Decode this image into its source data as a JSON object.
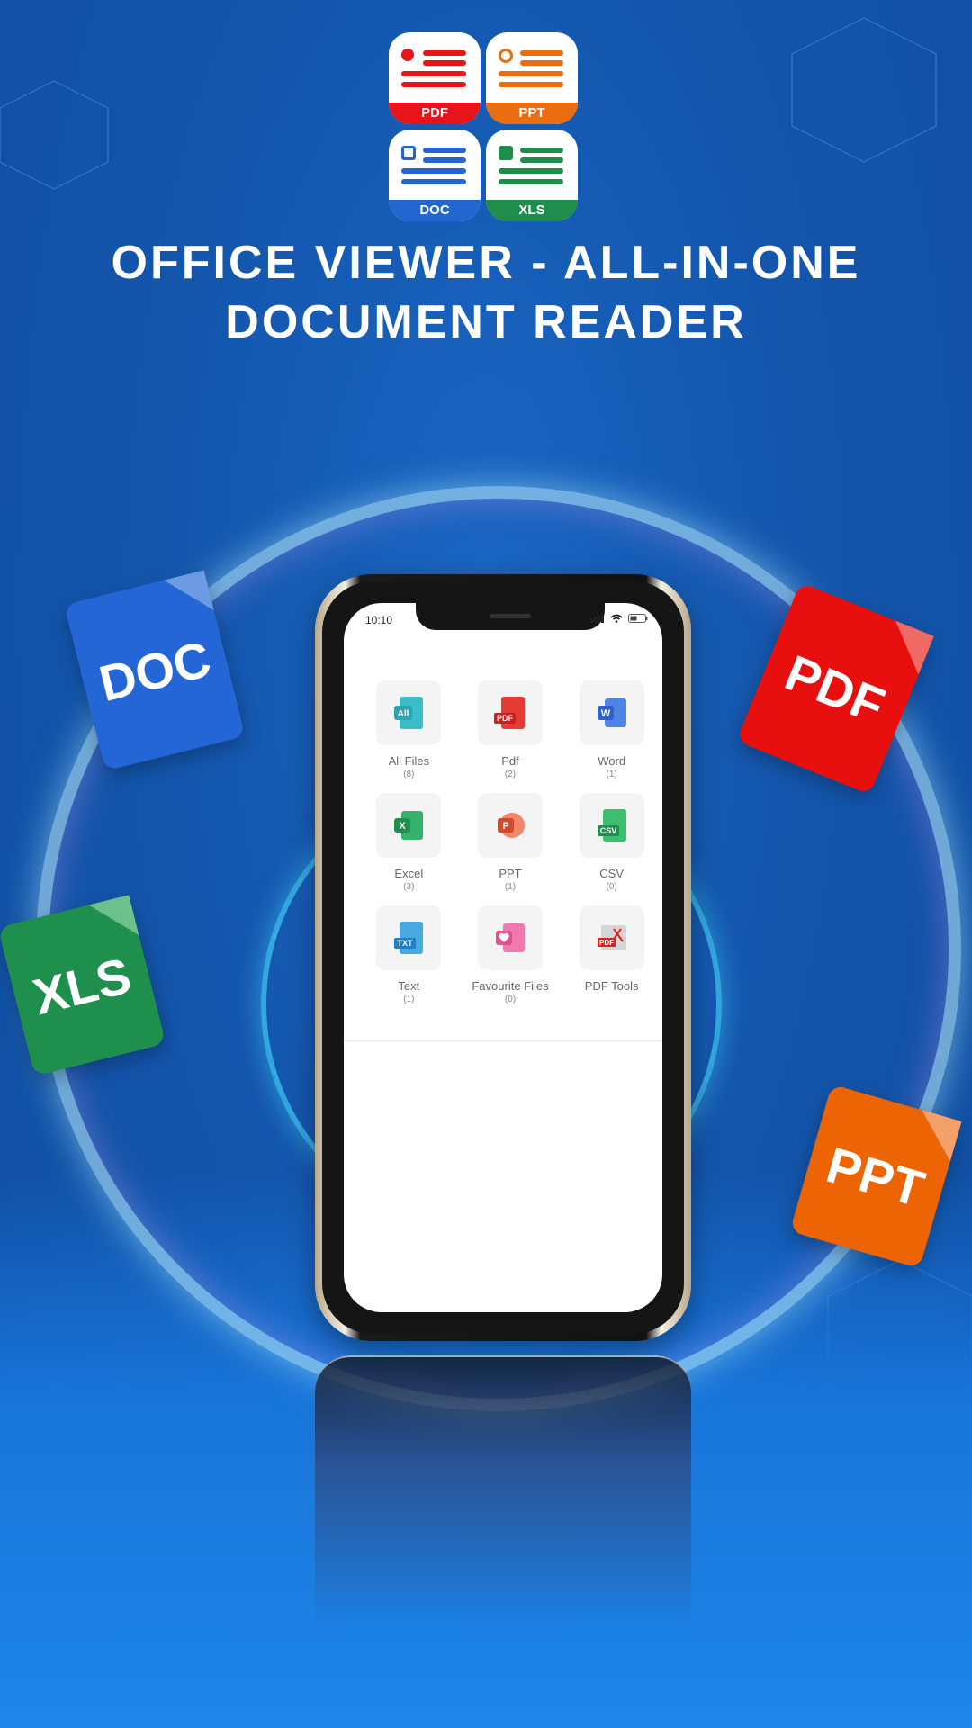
{
  "hero": {
    "logo_tiles": [
      {
        "label": "PDF",
        "color": "#e8141a"
      },
      {
        "label": "PPT",
        "color": "#ea6d10"
      },
      {
        "label": "DOC",
        "color": "#2466d0"
      },
      {
        "label": "XLS",
        "color": "#1e8e4a"
      }
    ],
    "title_line1": "OFFICE VIEWER - ALL-IN-ONE",
    "title_line2": "DOCUMENT READER"
  },
  "floaters": [
    {
      "label": "DOC",
      "color": "#2466d6",
      "fold_color": "#6d9be3"
    },
    {
      "label": "PDF",
      "color": "#e8100e",
      "fold_color": "#f06a64"
    },
    {
      "label": "XLS",
      "color": "#1f8f4e",
      "fold_color": "#6cc08e"
    },
    {
      "label": "PPT",
      "color": "#ec6404",
      "fold_color": "#f4a06a"
    }
  ],
  "phone": {
    "status_time": "10:10",
    "categories": [
      {
        "label": "All Files",
        "count": "(8)",
        "icon": "all-files-icon",
        "color": "#3bbcc8",
        "badge": "All"
      },
      {
        "label": "Pdf",
        "count": "(2)",
        "icon": "pdf-icon",
        "color": "#e33b36",
        "badge": "PDF"
      },
      {
        "label": "Word",
        "count": "(1)",
        "icon": "word-icon",
        "color": "#3d74d8",
        "badge": "W"
      },
      {
        "label": "Excel",
        "count": "(3)",
        "icon": "excel-icon",
        "color": "#27a761",
        "badge": "X"
      },
      {
        "label": "PPT",
        "count": "(1)",
        "icon": "powerpoint-icon",
        "color": "#e2583a",
        "badge": "P"
      },
      {
        "label": "CSV",
        "count": "(0)",
        "icon": "csv-icon",
        "color": "#2aaa5a",
        "badge": "CSV"
      },
      {
        "label": "Text",
        "count": "(1)",
        "icon": "text-file-icon",
        "color": "#3b98d8",
        "badge": "TXT"
      },
      {
        "label": "Favourite Files",
        "count": "(0)",
        "icon": "favourite-icon",
        "color": "#e85c9a",
        "badge": "♥"
      },
      {
        "label": "PDF Tools",
        "count": "",
        "icon": "pdf-tools-icon",
        "color": "#d9211e",
        "badge": "PDF"
      }
    ]
  }
}
